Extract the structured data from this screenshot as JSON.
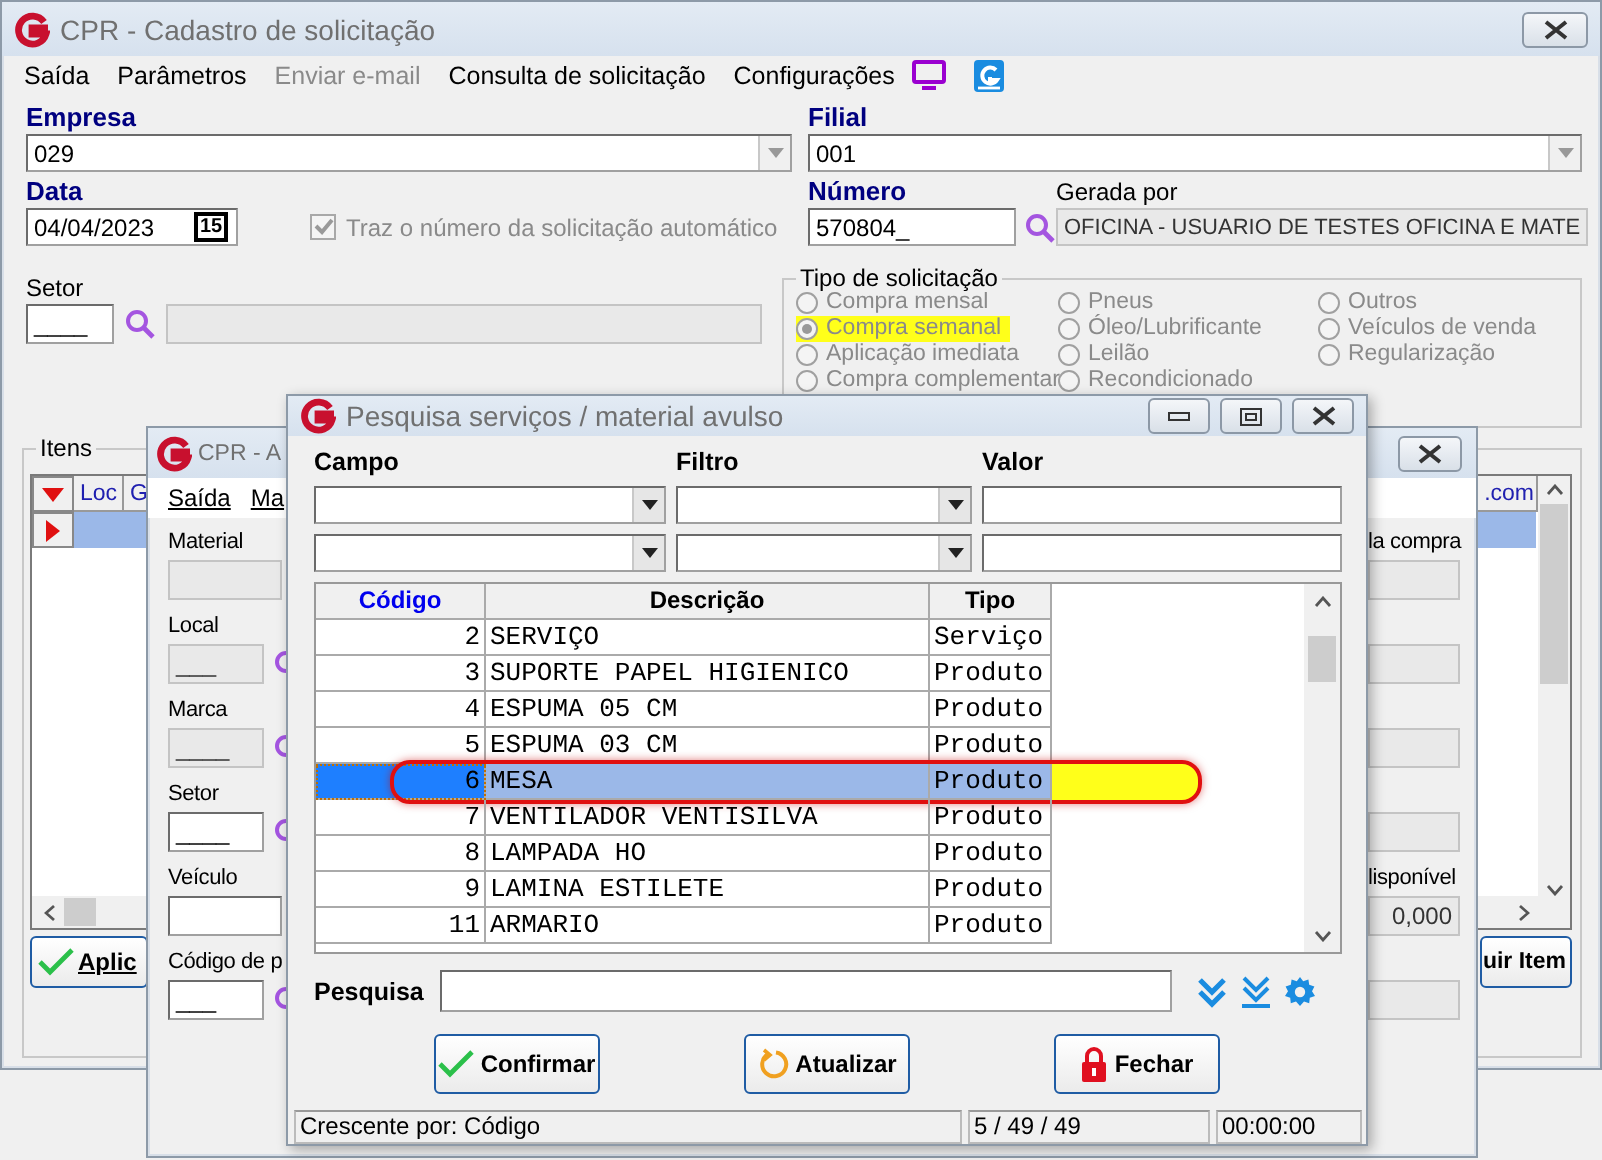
{
  "main_window": {
    "title": "CPR - Cadastro de solicitação",
    "menu": [
      {
        "label": "Saída",
        "disabled": false
      },
      {
        "label": "Parâmetros",
        "disabled": false
      },
      {
        "label": "Enviar e-mail",
        "disabled": true
      },
      {
        "label": "Consulta de solicitação",
        "disabled": false
      },
      {
        "label": "Configurações",
        "disabled": false
      }
    ],
    "empresa": {
      "label": "Empresa",
      "value": "029"
    },
    "filial": {
      "label": "Filial",
      "value": "001"
    },
    "data": {
      "label": "Data",
      "value": "04/04/2023",
      "calendar": "15"
    },
    "auto_number": {
      "label": "Traz o número da solicitação automático",
      "checked": true,
      "disabled": true
    },
    "numero": {
      "label": "Número",
      "value": "570804_"
    },
    "gerada_por": {
      "label": "Gerada por",
      "value": "OFICINA - USUARIO DE TESTES OFICINA E MATE"
    },
    "setor": {
      "label": "Setor",
      "value": "____"
    },
    "tipo_solicitacao": {
      "label": "Tipo de solicitação",
      "disabled": true,
      "options": [
        {
          "label": "Compra mensal",
          "selected": false,
          "highlighted": false
        },
        {
          "label": "Compra semanal",
          "selected": true,
          "highlighted": true
        },
        {
          "label": "Aplicação imediata",
          "selected": false,
          "highlighted": false
        },
        {
          "label": "Compra complementar",
          "selected": false,
          "highlighted": false
        },
        {
          "label": "Pneus",
          "selected": false,
          "highlighted": false
        },
        {
          "label": "Óleo/Lubrificante",
          "selected": false,
          "highlighted": false
        },
        {
          "label": "Leilão",
          "selected": false,
          "highlighted": false
        },
        {
          "label": "Recondicionado",
          "selected": false,
          "highlighted": false
        },
        {
          "label": "Outros",
          "selected": false,
          "highlighted": false
        },
        {
          "label": "Veículos de venda",
          "selected": false,
          "highlighted": false
        },
        {
          "label": "Regularização",
          "selected": false,
          "highlighted": false
        }
      ]
    },
    "itens": {
      "label": "Itens",
      "columns": [
        "Loc",
        "G"
      ],
      "right_column": ".com",
      "apply_button": "Aplic",
      "remove_button": "uir Item"
    }
  },
  "item_window": {
    "title": "CPR - A",
    "menu": [
      "Saída",
      "Ma"
    ],
    "rows": [
      {
        "left": {
          "label": "Material",
          "disabled": true,
          "search": false
        },
        "right": {
          "label": "la compra",
          "disabled": true
        }
      },
      {
        "left": {
          "label": "Local",
          "value": "___",
          "disabled": true,
          "search": true
        },
        "right": {
          "disabled": true
        }
      },
      {
        "left": {
          "label": "Marca",
          "value": "____",
          "disabled": true,
          "search": true
        },
        "right": {
          "disabled": true
        }
      },
      {
        "left": {
          "label": "Setor",
          "value": "____",
          "disabled": false,
          "search": true
        },
        "right": {
          "disabled": true
        }
      },
      {
        "left": {
          "label": "Veículo",
          "disabled": false,
          "search": false
        },
        "right": {
          "label": "lisponível",
          "value": "0,000",
          "disabled": true
        }
      },
      {
        "left": {
          "label": "Código de p",
          "value": "___",
          "disabled": false,
          "search": true
        },
        "right": {
          "disabled": true
        }
      }
    ]
  },
  "search_dialog": {
    "title": "Pesquisa serviços / material avulso",
    "filter_labels": [
      "Campo",
      "Filtro",
      "Valor"
    ],
    "table": {
      "columns": [
        {
          "label": "Código",
          "sorted": true
        },
        {
          "label": "Descrição",
          "sorted": false
        },
        {
          "label": "Tipo",
          "sorted": false
        }
      ],
      "rows": [
        {
          "codigo": "2",
          "descricao": "SERVIÇO",
          "tipo": "Serviço",
          "selected": false,
          "highlighted": false
        },
        {
          "codigo": "3",
          "descricao": "SUPORTE PAPEL HIGIENICO",
          "tipo": "Produto",
          "selected": false,
          "highlighted": false
        },
        {
          "codigo": "4",
          "descricao": "ESPUMA 05 CM",
          "tipo": "Produto",
          "selected": false,
          "highlighted": false
        },
        {
          "codigo": "5",
          "descricao": "ESPUMA 03 CM",
          "tipo": "Produto",
          "selected": false,
          "highlighted": false
        },
        {
          "codigo": "6",
          "descricao": "MESA",
          "tipo": "Produto",
          "selected": true,
          "highlighted": true
        },
        {
          "codigo": "7",
          "descricao": "VENTILADOR VENTISILVA",
          "tipo": "Produto",
          "selected": false,
          "highlighted": false
        },
        {
          "codigo": "8",
          "descricao": "LAMPADA HO",
          "tipo": "Produto",
          "selected": false,
          "highlighted": false
        },
        {
          "codigo": "9",
          "descricao": "LAMINA ESTILETE",
          "tipo": "Produto",
          "selected": false,
          "highlighted": false
        },
        {
          "codigo": "11",
          "descricao": "ARMARIO",
          "tipo": "Produto",
          "selected": false,
          "highlighted": false
        }
      ]
    },
    "search": {
      "label": "Pesquisa"
    },
    "buttons": [
      {
        "label": "Confirmar",
        "kind": "confirm"
      },
      {
        "label": "Atualizar",
        "kind": "refresh"
      },
      {
        "label": "Fechar",
        "kind": "close"
      }
    ],
    "status_bar": [
      "Crescente por: Código",
      "5 / 49 / 49",
      "00:00:00"
    ]
  }
}
